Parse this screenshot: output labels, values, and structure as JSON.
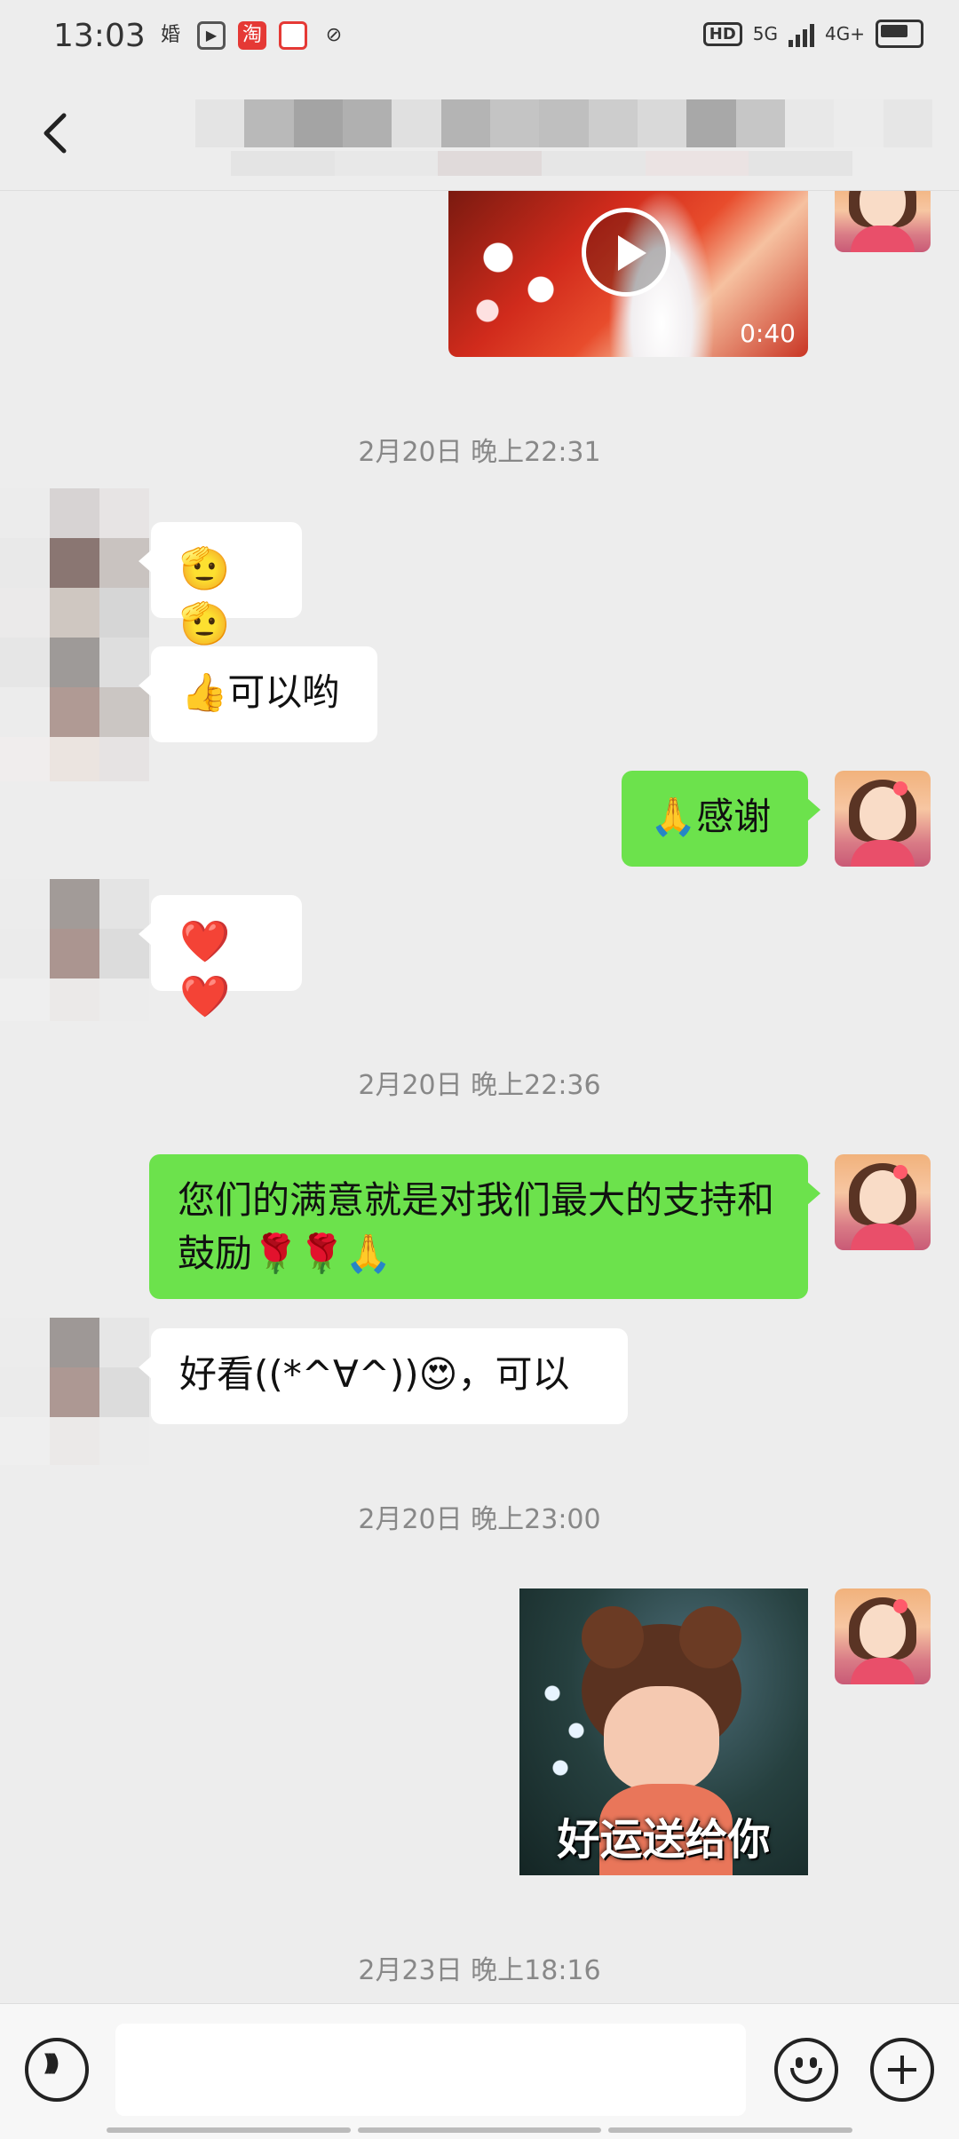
{
  "status_bar": {
    "time": "13:03",
    "left_icons": [
      "婚",
      "play-app-icon",
      "淘",
      "red-app-icon",
      "link-icon"
    ],
    "right_labels": [
      "HD",
      "5G",
      "4G+"
    ],
    "battery_icon": "battery-icon"
  },
  "nav": {
    "back_icon": "chevron-left-icon",
    "title_obscured": true
  },
  "video_message": {
    "duration": "0:40",
    "play_icon": "play-icon"
  },
  "timestamps": [
    "2月20日 晚上22:31",
    "2月20日 晚上22:36",
    "2月20日 晚上23:00",
    "2月23日 晚上18:16"
  ],
  "messages": [
    {
      "side": "in",
      "text": "🫡🫡"
    },
    {
      "side": "in",
      "text": "👍可以哟"
    },
    {
      "side": "out",
      "text": "🙏感谢"
    },
    {
      "side": "in",
      "text": "❤️❤️"
    },
    {
      "side": "out",
      "text": "您们的满意就是对我们最大的支持和鼓励🌹🌹🙏"
    },
    {
      "side": "in",
      "text": "好看((*^∀^))😍，可以"
    }
  ],
  "sticker": {
    "caption": "好运送给你"
  },
  "input_bar": {
    "placeholder": "",
    "voice_icon": "voice-icon",
    "emoji_icon": "emoji-icon",
    "plus_icon": "plus-icon"
  },
  "colors": {
    "background": "#ededed",
    "outgoing_bubble": "#6ce24c",
    "incoming_bubble": "#ffffff",
    "timestamp_text": "#888888"
  }
}
